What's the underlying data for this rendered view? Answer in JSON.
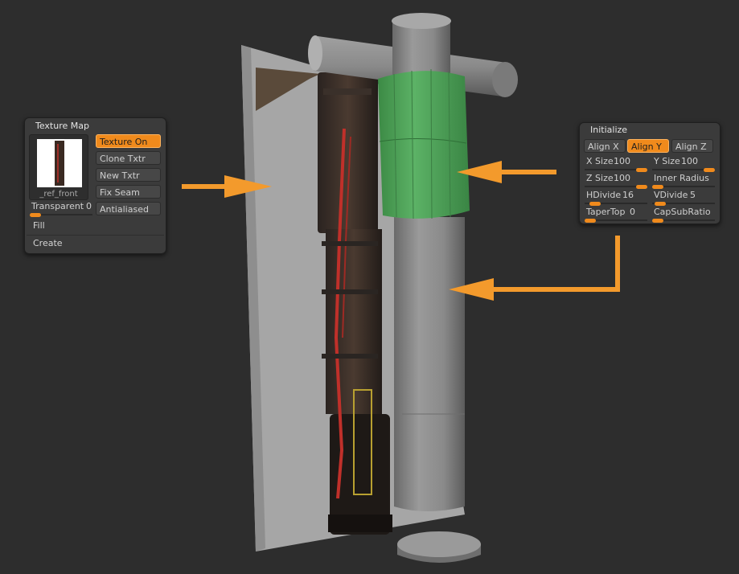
{
  "texture_map": {
    "title": "Texture Map",
    "thumbnail_label": "_ref_front",
    "buttons": [
      {
        "label": "Texture On",
        "active": true
      },
      {
        "label": "Clone Txtr",
        "active": false
      },
      {
        "label": "New Txtr",
        "active": false
      },
      {
        "label": "Fix Seam",
        "active": false
      },
      {
        "label": "Antialiased",
        "active": false
      }
    ],
    "transparent": {
      "label": "Transparent",
      "value": "0",
      "fraction": 0
    },
    "fill_label": "Fill",
    "create_label": "Create"
  },
  "initialize": {
    "title": "Initialize",
    "align": [
      {
        "label": "Align X",
        "active": false
      },
      {
        "label": "Align Y",
        "active": true
      },
      {
        "label": "Align Z",
        "active": false
      }
    ],
    "x_size": {
      "label": "X Size",
      "value": "100",
      "fraction": 1
    },
    "y_size": {
      "label": "Y Size",
      "value": "100",
      "fraction": 1
    },
    "z_size": {
      "label": "Z Size",
      "value": "100",
      "fraction": 1
    },
    "inner_radius": {
      "label": "Inner Radius",
      "value": "",
      "fraction": 0
    },
    "hdivide": {
      "label": "HDivide",
      "value": "16",
      "fraction": 0.1
    },
    "vdivide": {
      "label": "VDivide",
      "value": "5",
      "fraction": 0.05
    },
    "taper_top": {
      "label": "TaperTop",
      "value": "0",
      "fraction": 0
    },
    "cap_sub_ratio": {
      "label": "CapSubRatio",
      "value": "",
      "fraction": 0
    }
  },
  "colors": {
    "accent": "#f08a1c",
    "panel": "#3b3b3b",
    "background": "#2d2d2d",
    "highlight_mesh": "#4fa35a"
  }
}
